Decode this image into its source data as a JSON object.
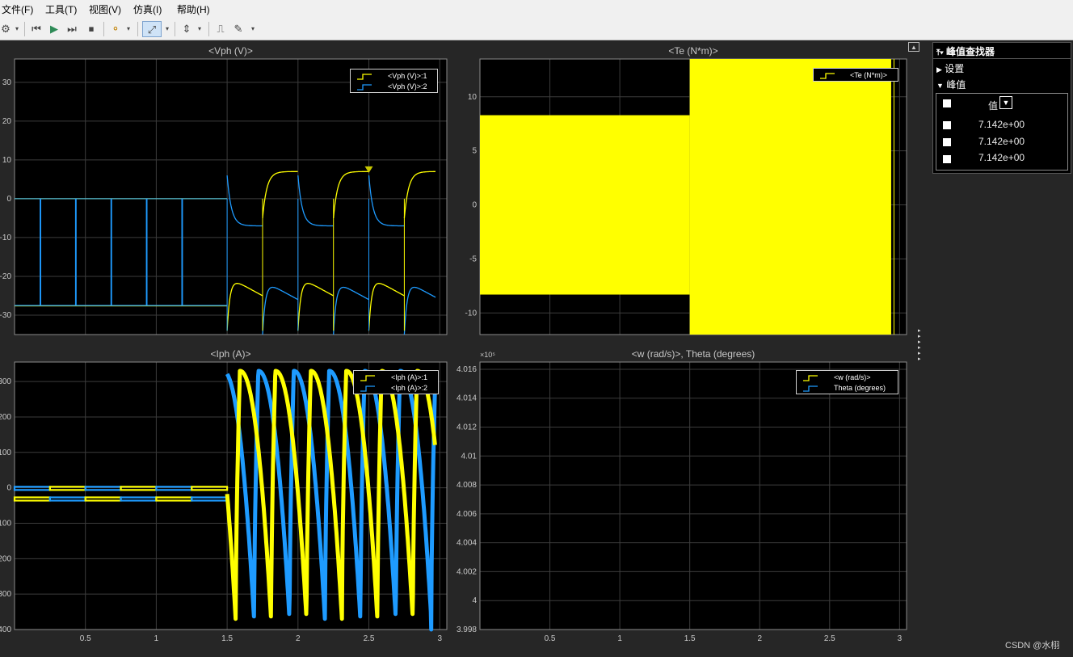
{
  "menu": [
    "文件(F)",
    "工具(T)",
    "视图(V)",
    "仿真(I)",
    "帮助(H)"
  ],
  "colors": {
    "yellow": "#ffff00",
    "blue": "#1e9bff",
    "plot_bg": "#000000",
    "window_bg": "#262626",
    "grid": "#3c3c3c",
    "text": "#c8c8c8"
  },
  "toolbar": {
    "icons": [
      "gear-icon",
      "dropdown-arrow-icon",
      "step-back-icon",
      "run-icon",
      "step-forward-icon",
      "stop-icon",
      "highlight-icon",
      "dropdown-arrow-icon",
      "zoom-icon",
      "dropdown-arrow-icon",
      "autoscale-icon",
      "dropdown-arrow-icon",
      "triggers-icon",
      "style-icon",
      "dropdown-arrow-icon"
    ]
  },
  "chart_data": [
    {
      "type": "line",
      "title": "<Vph (V)>",
      "xlim": [
        0,
        3.05
      ],
      "ylim": [
        -35,
        36
      ],
      "xticks": [],
      "yticks": [
        -30,
        -20,
        -10,
        0,
        10,
        20,
        30
      ],
      "legend": [
        "<Vph (V)>:1",
        "<Vph (V)>:2"
      ],
      "legend_position": "top-right",
      "series": [
        {
          "name": "<Vph (V)>:1",
          "color": "#ffff00"
        },
        {
          "name": "<Vph (V)>:2",
          "color": "#1e9bff"
        }
      ],
      "marker": {
        "x": 2.5,
        "y": 7.1
      }
    },
    {
      "type": "area",
      "title": "<Te (N*m)>",
      "xlim": [
        0,
        3.05
      ],
      "ylim": [
        -12,
        13.5
      ],
      "xticks": [],
      "yticks": [
        -10,
        -5,
        0,
        5,
        10
      ],
      "legend": [
        "<Te (N*m)>"
      ],
      "legend_position": "top-right",
      "series": [
        {
          "name": "<Te (N*m)>",
          "color": "#ffff00"
        }
      ]
    },
    {
      "type": "line",
      "title": "<Iph (A)>",
      "xlim": [
        0,
        3.05
      ],
      "ylim": [
        -400,
        355
      ],
      "xticks": [
        0.5,
        1,
        1.5,
        2,
        2.5,
        3
      ],
      "yticks": [
        -400,
        -300,
        -200,
        -100,
        0,
        100,
        200,
        300
      ],
      "legend": [
        "<Iph (A)>:1",
        "<Iph (A)>:2"
      ],
      "legend_position": "top-right",
      "series": [
        {
          "name": "<Iph (A)>:1",
          "color": "#ffff00"
        },
        {
          "name": "<Iph (A)>:2",
          "color": "#1e9bff"
        }
      ]
    },
    {
      "type": "line",
      "title": "<w (rad/s)>, Theta (degrees)",
      "xlim": [
        0,
        3.05
      ],
      "ylim": [
        3.998,
        4.0165
      ],
      "y_multiplier": "×10⁵",
      "xticks": [
        0.5,
        1,
        1.5,
        2,
        2.5,
        3
      ],
      "yticks": [
        3.998,
        4,
        4.002,
        4.004,
        4.006,
        4.008,
        4.01,
        4.012,
        4.014,
        4.016
      ],
      "legend": [
        "<w (rad/s)>",
        "Theta (degrees)"
      ],
      "legend_position": "top-right",
      "series": [
        {
          "name": "<w (rad/s)>",
          "color": "#ffff00"
        },
        {
          "name": "Theta (degrees)",
          "color": "#1e9bff"
        }
      ]
    }
  ],
  "peak_finder": {
    "title": "峰值查找器",
    "settings": "设置",
    "peaks": "峰值",
    "value_header": "值",
    "values": [
      "7.142e+00",
      "7.142e+00",
      "7.142e+00"
    ]
  },
  "watermark": "CSDN @水栩"
}
